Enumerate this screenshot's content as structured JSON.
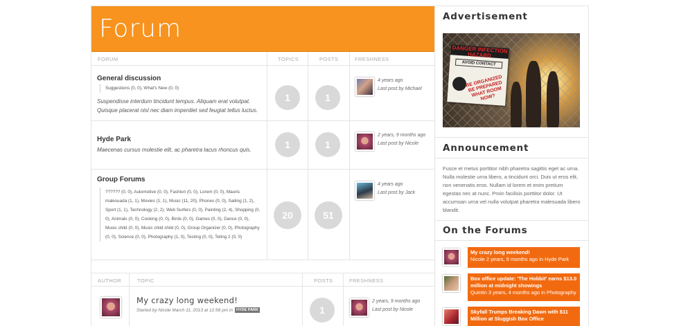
{
  "forum": {
    "title": "Forum",
    "columns": {
      "forum": "FORUM",
      "topics": "TOPICS",
      "posts": "POSTS",
      "freshness": "FRESHNESS"
    },
    "rows": [
      {
        "title": "General discussion",
        "subforums": "Suggestions (0, 0), What's New (0, 0)",
        "description": "Suspendisse interdum tincidunt tempus. Aliquam erat volutpat. Quisque placerat nisl nec diam imperdiet sed feugiat tellus luctus.",
        "topics": "1",
        "posts": "1",
        "freshness_time": "4 years ago",
        "freshness_by": "Last post by Michael"
      },
      {
        "title": "Hyde Park",
        "description": "Maecenas cursus molestie elit, ac pharetra lacus rhoncus quis.",
        "topics": "1",
        "posts": "1",
        "freshness_time": "2 years, 9 months ago",
        "freshness_by": "Last post by Nicole"
      },
      {
        "title": "Group Forums",
        "subforums": "?????? (0, 0), Automotive (0, 0), Fashion (0, 0), Lorem (0, 0), Mauris malesuada (1, 1), Movies (1, 1), Music (11, 20), Phones (0, 0), Sailing (1, 2), Sport (1, 1), Technology (2, 2), Web Surfers (0, 0), Painting (2, 4), Shopping (0, 0), Animals (0, 0), Cooking (0, 0), Birds (0, 0), Games (0, 0), Dance (0, 0), Music child (0, 0), Music child child (0, 0), Group Organizer (0, 0), Photography (0, 0), Science (0, 0), Photography (1, 0), Testing (0, 0), Teting 2 (0, 0)",
        "topics": "20",
        "posts": "51",
        "freshness_time": "4 years ago",
        "freshness_by": "Last post by Jack"
      }
    ]
  },
  "topics_table": {
    "columns": {
      "author": "AUTHOR",
      "topic": "TOPIC",
      "posts": "POSTS",
      "freshness": "FRESHNESS"
    },
    "rows": [
      {
        "title": "My crazy long weekend!",
        "started": "Started by Nicole March 11, 2013 at 12:58 pm in",
        "tag": "HYDE PARK",
        "posts": "1",
        "freshness_time": "2 years, 9 months ago",
        "freshness_by": "Last post by Nicole"
      }
    ]
  },
  "sidebar": {
    "advertisement_title": "Advertisement",
    "ad_sign": {
      "top": "DANGER INFECTION HAZARD",
      "mid": "AVOID CONTACT",
      "scrawl": "BE ORGANIZED BE PREPARED WHAT ROOM NOW?"
    },
    "announcement_title": "Announcement",
    "announcement_text": "Fusce et metus porttitor nibh pharetra sagittis eget ac urna. Nulla molestie urna libero, a tincidunt orci. Duis ut eros elit, non venenatis eros. Nullam id lorem et enim pretium egestas nec at nunc. Proin facilisis porttitor dolor. Ut accumsan urna vel nulla volutpat pharetra malesuada libero blandit.",
    "on_forums_title": "On the Forums",
    "on_forums": [
      {
        "title": "My crazy long weekend!",
        "meta": "Nicole 2 years, 9 months ago in Hyde Park"
      },
      {
        "title": "Box office update: 'The Hobbit' earns $13.0 million at midnight showings",
        "meta": "Quintin 3 years, 4 months ago in Photography"
      },
      {
        "title": "Skyfall Trumps Breaking Dawn with $11 Million at Sluggish Box Office",
        "meta": ""
      }
    ]
  },
  "colors": {
    "accent": "#f7931e",
    "on_forums_box": "#f26a10",
    "bubble": "#d9d9d9"
  }
}
